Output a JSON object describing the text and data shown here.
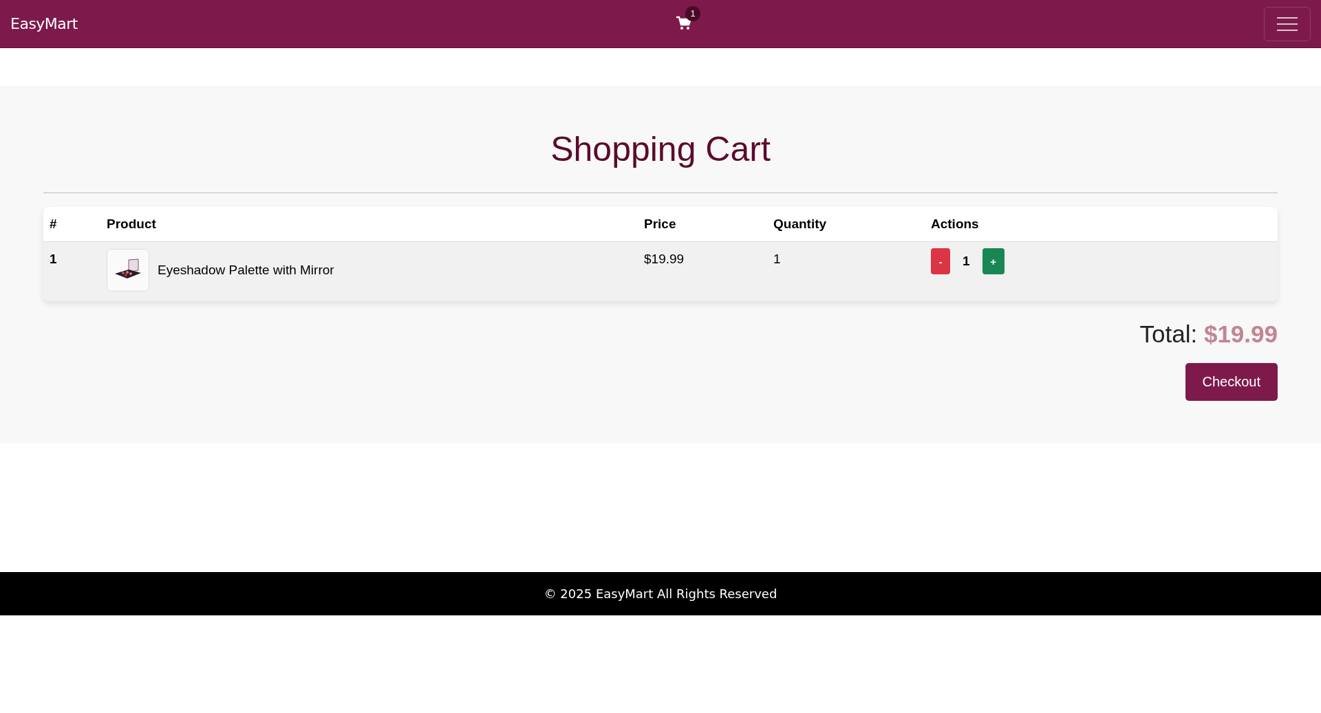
{
  "navbar": {
    "brand": "EasyMart",
    "cart_count": "1"
  },
  "page": {
    "title": "Shopping Cart"
  },
  "table": {
    "columns": [
      "#",
      "Product",
      "Price",
      "Quantity",
      "Actions"
    ],
    "rows": [
      {
        "index": "1",
        "product": "Eyeshadow Palette with Mirror",
        "price": "$19.99",
        "quantity": "1",
        "decrease": "-",
        "count": "1",
        "increase": "+"
      }
    ]
  },
  "total": {
    "label": "Total:",
    "amount": "$19.99"
  },
  "checkout": "Checkout",
  "footer": "© 2025 EasyMart All Rights Reserved"
}
